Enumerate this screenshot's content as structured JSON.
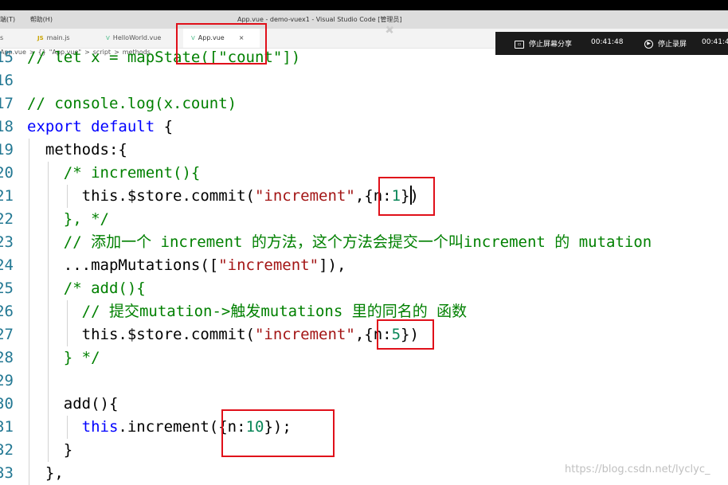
{
  "menu": [
    "端(T)",
    "帮助(H)"
  ],
  "window_title": "App.vue - demo-vuex1 - Visual Studio Code [管理员]",
  "tabs": [
    {
      "label": "s",
      "icon": ""
    },
    {
      "label": "main.js",
      "icon": "JS"
    },
    {
      "label": "HelloWorld.vue",
      "icon": "V"
    },
    {
      "label": "App.vue",
      "icon": "V",
      "active": true,
      "close": "×"
    }
  ],
  "recorder": {
    "share_label": "停止屏幕分享",
    "share_time": "00:41:48",
    "stop_label": "停止录屏",
    "stop_time": "00:41:4"
  },
  "breadcrumb": [
    "App.vue",
    ">",
    "{}",
    "\"App.vue\"",
    ">",
    "script",
    ">",
    "methods"
  ],
  "code_lines": [
    {
      "num": "15",
      "text": "// let x = mapState([\"count\"])"
    },
    {
      "num": "16",
      "text": ""
    },
    {
      "num": "17",
      "text": "// console.log(x.count)"
    },
    {
      "num": "18",
      "text": "export default {"
    },
    {
      "num": "19",
      "text": "  methods:{"
    },
    {
      "num": "20",
      "text": "    /* increment(){"
    },
    {
      "num": "21",
      "text": "      this.$store.commit(\"increment\",{n:1})"
    },
    {
      "num": "22",
      "text": "    }, */"
    },
    {
      "num": "23",
      "text": "    // 添加一个 increment 的方法，这个方法会提交一个叫increment 的 mutation"
    },
    {
      "num": "24",
      "text": "    ...mapMutations([\"increment\"]),"
    },
    {
      "num": "25",
      "text": "    /* add(){"
    },
    {
      "num": "26",
      "text": "      // 提交mutation->触发mutations 里的同名的 函数"
    },
    {
      "num": "27",
      "text": "      this.$store.commit(\"increment\",{n:5})"
    },
    {
      "num": "28",
      "text": "    } */"
    },
    {
      "num": "29",
      "text": ""
    },
    {
      "num": "30",
      "text": "    add(){"
    },
    {
      "num": "31",
      "text": "      this.increment({n:10});"
    },
    {
      "num": "32",
      "text": "    }"
    },
    {
      "num": "33",
      "text": "  },"
    }
  ],
  "code_tokens": {
    "l18_kw1": "export",
    "l18_kw2": "default",
    "l18_rest": " {",
    "l21_pre": "this.$store.commit(",
    "l21_str": "\"increment\"",
    "l21_post1": ",{n:",
    "l21_num": "1",
    "l21_post2": "})",
    "l24_pre": "...mapMutations([",
    "l24_str": "\"increment\"",
    "l24_post": "]),",
    "l27_pre": "this.$store.commit(",
    "l27_str": "\"increment\"",
    "l27_post1": ",{n:",
    "l27_num": "5",
    "l27_post2": "})",
    "l31_this": "this",
    "l31_mid": ".increment({n:",
    "l31_num": "10",
    "l31_post": "});"
  },
  "watermark": "https://blog.csdn.net/lyclyc_",
  "colors": {
    "highlight": "#e0101a",
    "keyword": "#0000ff",
    "comment": "#008000",
    "string": "#a31515",
    "number": "#098658"
  }
}
